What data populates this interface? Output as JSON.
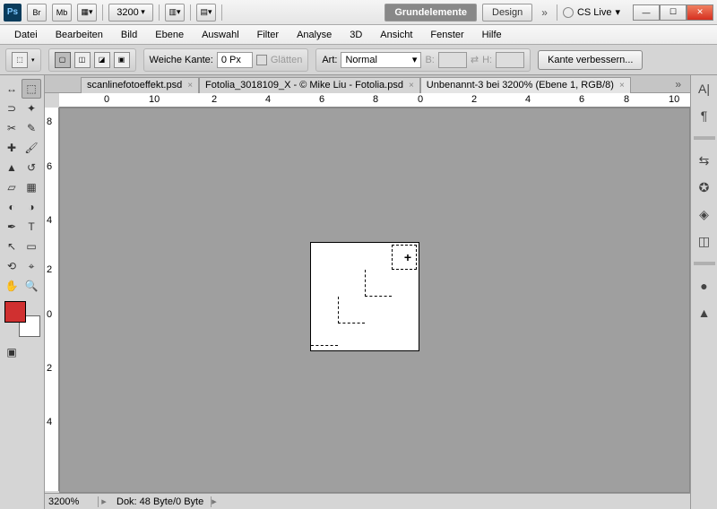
{
  "titlebar": {
    "logo": "Ps",
    "br": "Br",
    "mb": "Mb",
    "zoom": "3200",
    "ws1": "Grundelemente",
    "ws2": "Design",
    "cslive": "CS Live"
  },
  "menu": [
    "Datei",
    "Bearbeiten",
    "Bild",
    "Ebene",
    "Auswahl",
    "Filter",
    "Analyse",
    "3D",
    "Ansicht",
    "Fenster",
    "Hilfe"
  ],
  "opt": {
    "weiche": "Weiche Kante:",
    "weiche_val": "0 Px",
    "glatten": "Glätten",
    "art": "Art:",
    "art_val": "Normal",
    "B": "B:",
    "H": "H:",
    "verb": "Kante verbessern..."
  },
  "tabs": [
    {
      "name": "scanlinefotoeffekt.psd"
    },
    {
      "name": "Fotolia_3018109_X - © Mike Liu - Fotolia.psd"
    },
    {
      "name": "Unbenannt-3 bei 3200% (Ebene 1, RGB/8)"
    }
  ],
  "status": {
    "zoom": "3200%",
    "dok": "Dok: 48 Byte/0 Byte"
  },
  "rulerh": [
    "0",
    "10",
    "2",
    "4",
    "6",
    "8",
    "0",
    "2",
    "4",
    "6",
    "8",
    "10"
  ],
  "rulerv": [
    "8",
    "6",
    "4",
    "2",
    "0",
    "2",
    "4"
  ]
}
